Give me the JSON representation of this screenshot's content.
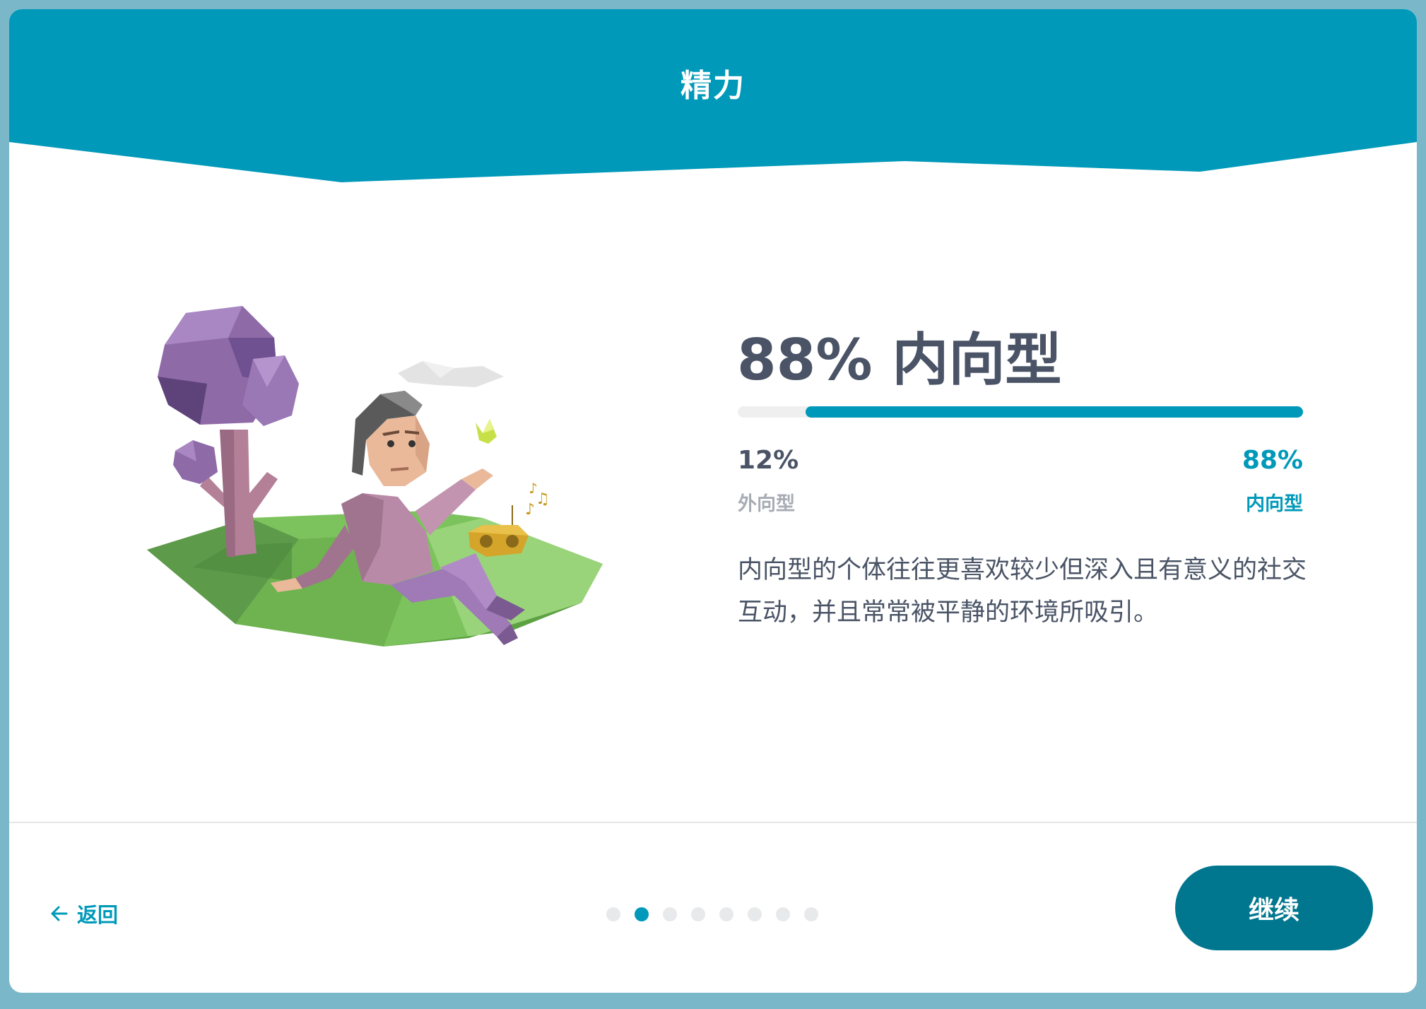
{
  "header": {
    "title": "精力",
    "color": "#0099b9"
  },
  "result": {
    "heading": "88% 内向型",
    "introvert_fraction": 0.88,
    "left_percent": "12%",
    "left_label": "外向型",
    "right_percent": "88%",
    "right_label": "内向型",
    "description": "内向型的个体往往更喜欢较少但深入且有意义的社交互动，并且常常被平静的环境所吸引。"
  },
  "footer": {
    "back_label": "返回",
    "continue_label": "继续",
    "pager": {
      "total": 8,
      "active_index": 1
    }
  },
  "colors": {
    "accent": "#0099b9",
    "button": "#00778f",
    "text_dark": "#4a5466",
    "text_muted": "#a7acb4"
  },
  "icons": {
    "back": "arrow-left-icon"
  }
}
